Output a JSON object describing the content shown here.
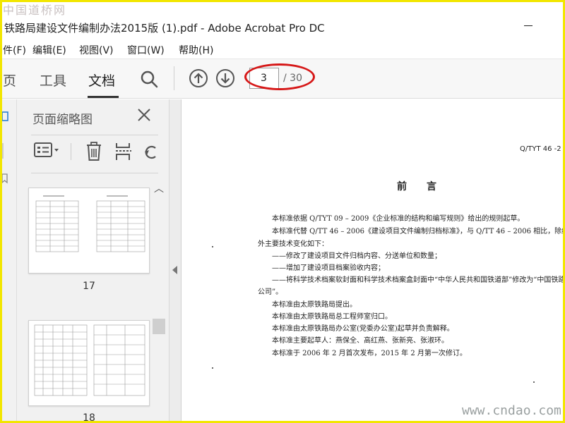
{
  "watermark": {
    "top": "中国道桥网",
    "bottom": "www.cndao.com"
  },
  "window": {
    "title": "铁路局建设文件编制办法2015版 (1).pdf - Adobe Acrobat Pro DC"
  },
  "menu": [
    "件(F)",
    "编辑(E)",
    "视图(V)",
    "窗口(W)",
    "帮助(H)"
  ],
  "toolbar": {
    "tabs": [
      "页",
      "工具",
      "文档"
    ],
    "active_tab": "文档",
    "current_page": "3",
    "total_pages": "/ 30"
  },
  "thumbnails_panel": {
    "title": "页面缩略图",
    "pages": [
      {
        "label": "17"
      },
      {
        "label": "18"
      }
    ]
  },
  "document": {
    "header_code": "Q/TYT 46 -2",
    "heading": "前言",
    "lines": [
      "本标准依据 Q/TYT 09 – 2009《企业标准的结构和编写规则》给出的规则起草。",
      "本标准代替 Q/TT 46 – 2006《建设项目文件编制归档标准》，与 Q/TT 46 – 2006 相比，除编辑性(",
      "外主要技术变化如下：",
      "——修改了建设项目文件归档内容、分送单位和数量；",
      "——增加了建设项目档案验收内容；",
      "——将科学技术档案软封面和科学技术档案盒封面中“中华人民共和国铁道部”修改为“中国铁路",
      "公司”。",
      "本标准由太原铁路局提出。",
      "本标准由太原铁路局总工程师室归口。",
      "本标准由太原铁路局办公室(党委办公室)起草并负责解释。",
      "本标准主要起草人：燕保全、高红燕、张新亮、张淑环。",
      "本标准于 2006 年 2 月首次发布，2015 年 2 月第一次修订。"
    ]
  },
  "colors": {
    "highlight": "#d61818",
    "frame": "#f2e600"
  }
}
